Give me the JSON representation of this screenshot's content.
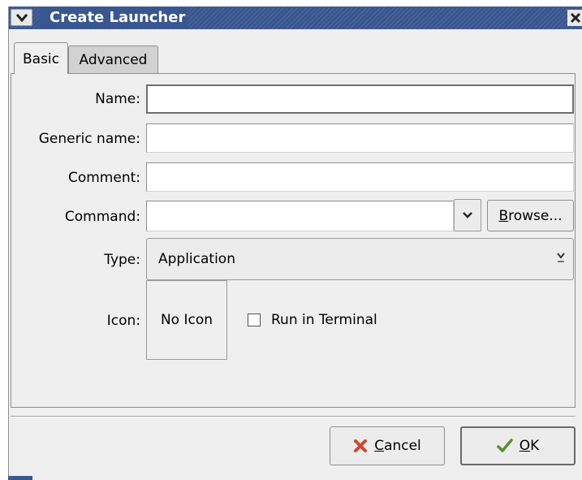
{
  "window": {
    "title": "Create Launcher",
    "menu_icon": "chevron-down-icon",
    "close_icon": "close-icon",
    "accent_color": "#39568f"
  },
  "tabs": [
    {
      "label": "Basic",
      "active": true
    },
    {
      "label": "Advanced",
      "active": false
    }
  ],
  "form": {
    "name": {
      "label": "Name:",
      "value": ""
    },
    "generic_name": {
      "label": "Generic name:",
      "value": ""
    },
    "comment": {
      "label": "Comment:",
      "value": ""
    },
    "command": {
      "label": "Command:",
      "value": "",
      "browse_label_mnemonic": "B",
      "browse_label_rest": "rowse..."
    },
    "type": {
      "label": "Type:",
      "selected": "Application"
    },
    "icon": {
      "label": "Icon:",
      "button_label": "No Icon"
    },
    "run_in_terminal": {
      "label": "Run in Terminal",
      "checked": false
    }
  },
  "buttons": {
    "cancel": {
      "mnemonic": "C",
      "rest": "ancel",
      "icon": "cancel-x-icon",
      "icon_color": "#d2452f"
    },
    "ok": {
      "mnemonic": "O",
      "rest": "K",
      "icon": "checkmark-icon",
      "icon_color": "#5b8f2e"
    }
  }
}
